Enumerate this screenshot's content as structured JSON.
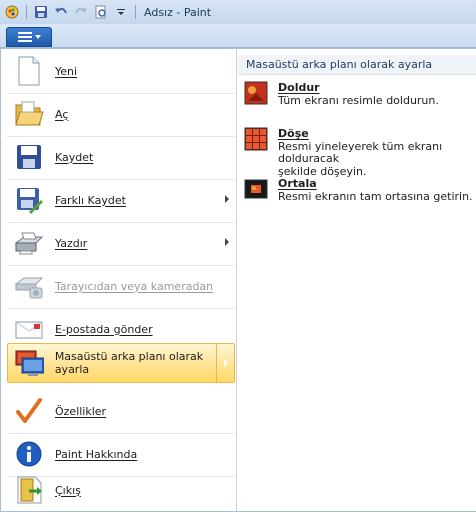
{
  "window": {
    "title": "Adsız - Paint"
  },
  "quick_access": [
    {
      "icon": "paint-app-icon"
    },
    {
      "icon": "save-icon"
    },
    {
      "icon": "undo-icon"
    },
    {
      "icon": "redo-icon"
    },
    {
      "icon": "print-preview-icon"
    },
    {
      "icon": "customize-dropdown-icon"
    }
  ],
  "app_menu": {
    "items": [
      {
        "label": "Yeni",
        "icon": "new-file-icon"
      },
      {
        "label": "Aç",
        "icon": "open-folder-icon"
      },
      {
        "label": "Kaydet",
        "icon": "save-disk-icon"
      },
      {
        "label": "Farklı Kaydet",
        "icon": "save-as-icon"
      },
      {
        "label": "Yazdır",
        "icon": "printer-icon"
      },
      {
        "label": "Tarayıcıdan veya kameradan",
        "icon": "scanner-icon"
      },
      {
        "label": "E-postada gönder",
        "icon": "email-icon"
      },
      {
        "label": "Masaüstü arka planı olarak ayarla",
        "icon": "desktop-background-icon"
      },
      {
        "label": "Özellikler",
        "icon": "checkmark-icon"
      },
      {
        "label": "Paint Hakkında",
        "icon": "info-icon"
      },
      {
        "label": "Çıkış",
        "icon": "exit-icon"
      }
    ]
  },
  "submenu": {
    "header": "Masaüstü arka planı olarak ayarla",
    "options": [
      {
        "title": "Doldur",
        "desc_line1": "Tüm ekranı resimle doldurun.",
        "desc_line2": "",
        "icon": "fill-icon"
      },
      {
        "title": "Döşe",
        "desc_line1": "Resmi yineleyerek tüm ekranı dolduracak",
        "desc_line2": "şekilde döşeyin.",
        "icon": "tile-icon"
      },
      {
        "title": "Ortala",
        "desc_line1": "Resmi ekranın tam ortasına getirin.",
        "desc_line2": "",
        "icon": "center-icon"
      }
    ]
  },
  "colors": {
    "active_highlight": "#ffd866",
    "app_button": "#1e5aa8",
    "disabled_text": "#9a9a9a"
  }
}
